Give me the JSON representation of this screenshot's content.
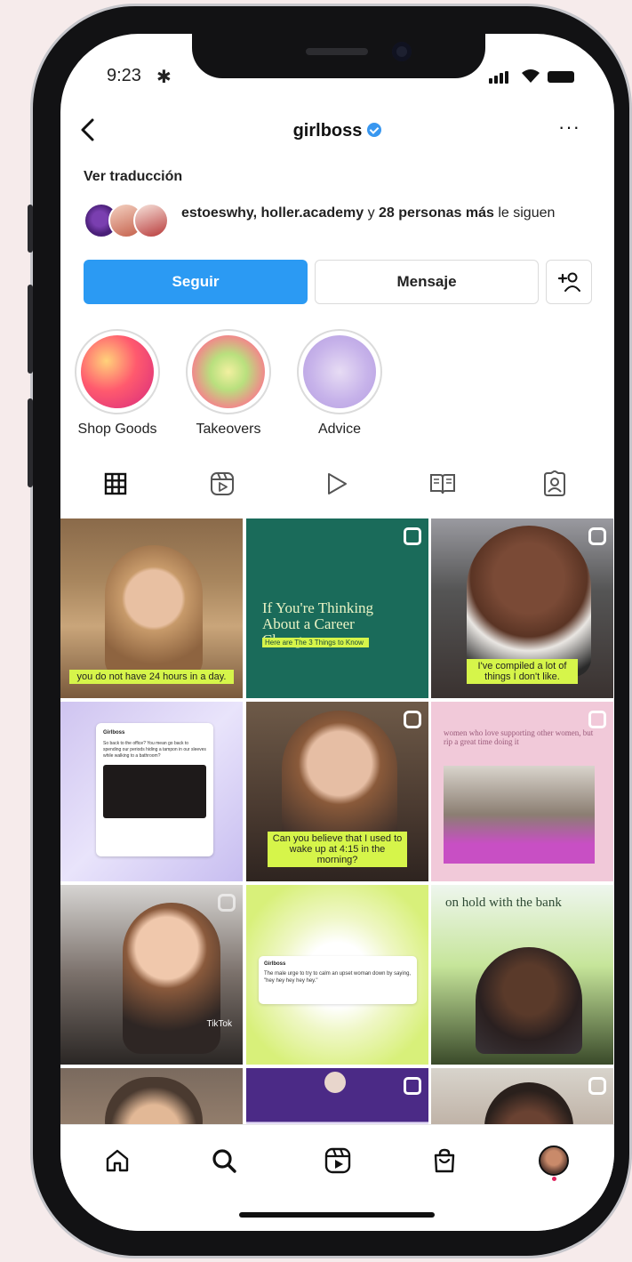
{
  "status": {
    "time": "9:23"
  },
  "header": {
    "username": "girlboss"
  },
  "profile": {
    "translate_link": "Ver traducción",
    "followed_by_names": "estoeswhy, holler.academy",
    "followed_by_joiner": " y ",
    "followed_by_count": "28 personas más",
    "followed_by_tail": " le siguen"
  },
  "actions": {
    "follow_label": "Seguir",
    "message_label": "Mensaje"
  },
  "highlights": [
    {
      "label": "Shop Goods"
    },
    {
      "label": "Takeovers"
    },
    {
      "label": "Advice"
    }
  ],
  "tabs": [
    "grid-icon",
    "reels-icon",
    "video-icon",
    "guides-icon",
    "tagged-icon"
  ],
  "posts": [
    {
      "caption": "you do not have 24 hours in a day."
    },
    {
      "title": "If You're Thinking About a Career Change...",
      "subtitle": "Here are The 3 Things to Know"
    },
    {
      "caption": "I've compiled a lot of things I don't like."
    },
    {
      "tweet_name": "Girlboss",
      "tweet_text": "So back to the office? You mean go back to spending our periods hiding a tampon in our sleeves while walking to a bathroom?"
    },
    {
      "caption": "Can you believe that I used to wake up at 4:15 in the morning?"
    },
    {
      "header_text": "women who love supporting other women, but rip a great time doing it"
    },
    {
      "overlay": "TikTok"
    },
    {
      "tweet_name": "Girlboss",
      "tweet_text": "The male urge to try to calm an upset woman down by saying, \"hey hey hey hey hey.\""
    },
    {
      "header_text": "on hold with the bank"
    }
  ],
  "colors": {
    "accent": "#2b9af3",
    "caption_bg": "#d6f54a",
    "verified": "#3897f0"
  }
}
